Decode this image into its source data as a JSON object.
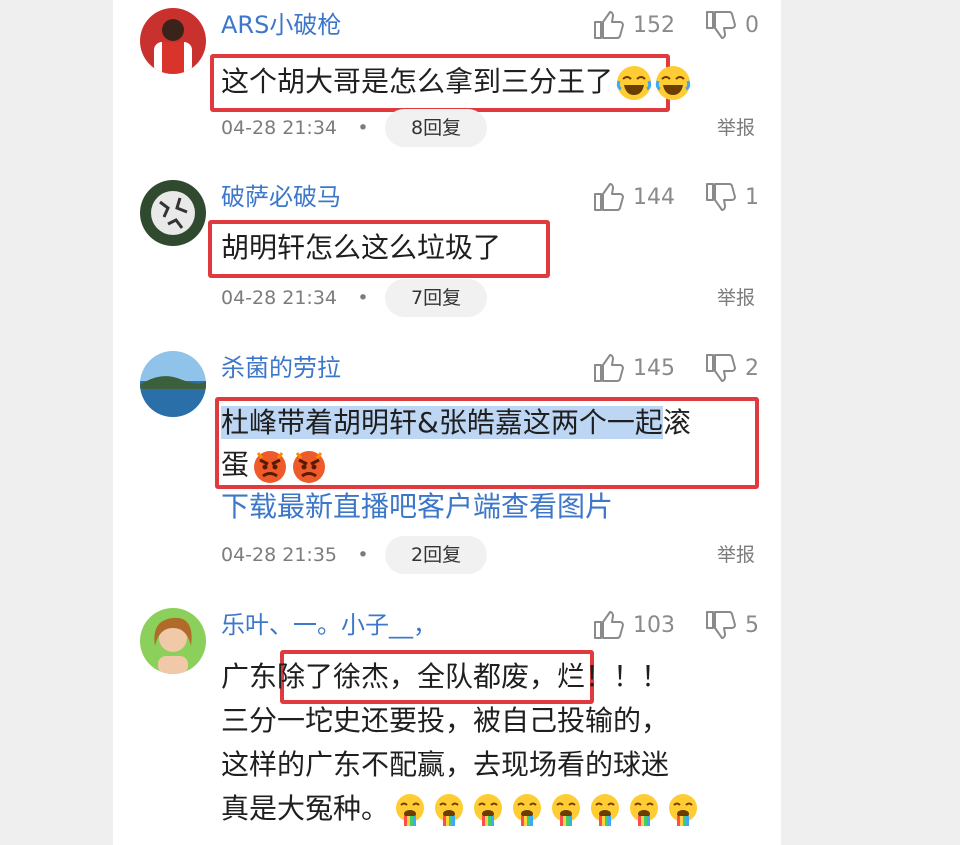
{
  "comments": [
    {
      "username": "ARS小破枪",
      "likes": "152",
      "dislikes": "0",
      "text_lines": [
        "这个胡大哥是怎么拿到三分王了"
      ],
      "emoji": [
        "laugh-cry-emoji",
        "laugh-cry-emoji"
      ],
      "time": "04-28 21:34",
      "dot": "•",
      "replies": "8回复",
      "report": "举报"
    },
    {
      "username": "破萨必破马",
      "likes": "144",
      "dislikes": "1",
      "text_lines": [
        "胡明轩怎么这么垃圾了"
      ],
      "time": "04-28 21:34",
      "dot": "•",
      "replies": "7回复",
      "report": "举报"
    },
    {
      "username": "杀菌的劳拉",
      "likes": "145",
      "dislikes": "2",
      "text_highlighted": "杜峰带着胡明轩&张皓嘉这两个一起",
      "text_rest": "滚",
      "text_line2": "蛋",
      "emoji": [
        "angry-face-emoji",
        "angry-face-emoji"
      ],
      "download_link": "下载最新直播吧客户端查看图片",
      "time": "04-28 21:35",
      "dot": "•",
      "replies": "2回复",
      "report": "举报"
    },
    {
      "username": "乐叶、一。小子__，",
      "likes": "103",
      "dislikes": "5",
      "line1_pre": "广东",
      "line1_boxed": "除了徐杰，全队都废，",
      "line1_post": "烂！！！",
      "line2": "三分一坨史还要投，被自己投输的，",
      "line3": "这样的广东不配赢，去现场看的球迷",
      "line4": "真是大冤种。",
      "emoji": [
        "rainbow-cry-emoji",
        "rainbow-cry-emoji",
        "rainbow-cry-emoji",
        "rainbow-cry-emoji",
        "rainbow-cry-emoji",
        "rainbow-cry-emoji",
        "rainbow-cry-emoji",
        "rainbow-cry-emoji"
      ]
    }
  ],
  "colors": {
    "username": "#3d77c9",
    "highlight_box": "#e0393e",
    "selection": "#bdd6f4"
  }
}
